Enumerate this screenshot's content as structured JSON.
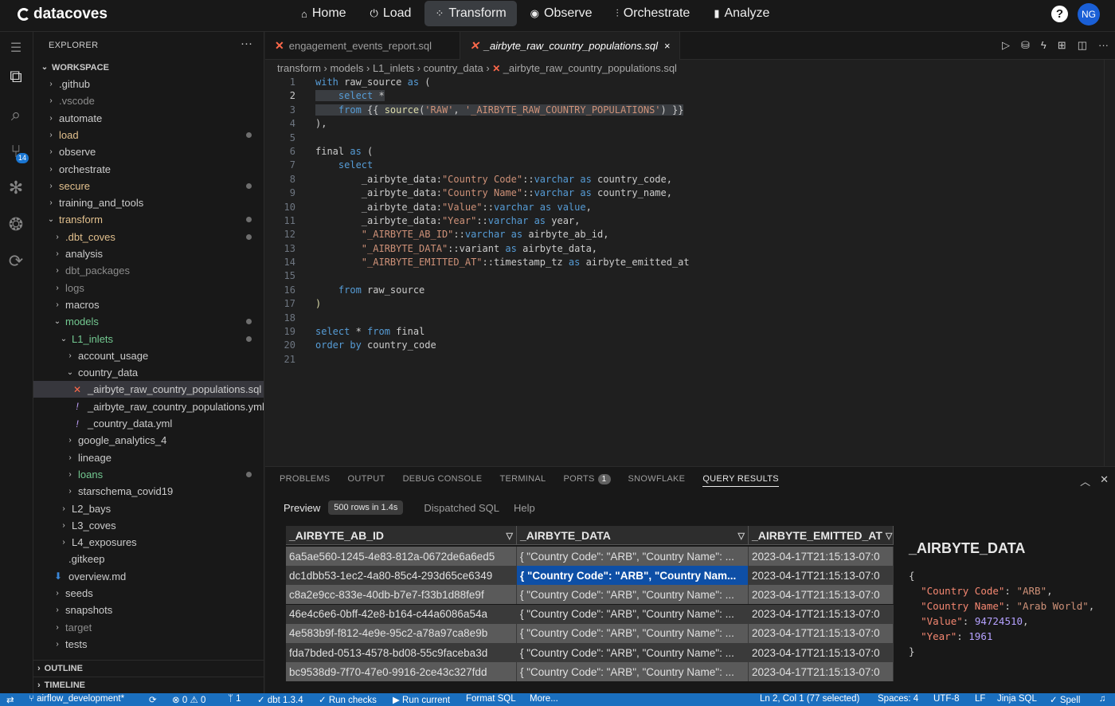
{
  "brand": "datacoves",
  "nav": {
    "tabs": [
      {
        "label": "Home",
        "icon": "home-icon"
      },
      {
        "label": "Load",
        "icon": "load-icon"
      },
      {
        "label": "Transform",
        "icon": "transform-icon",
        "active": true
      },
      {
        "label": "Observe",
        "icon": "eye-icon"
      },
      {
        "label": "Orchestrate",
        "icon": "orchestrate-icon"
      },
      {
        "label": "Analyze",
        "icon": "bar-chart-icon"
      }
    ],
    "help": "?",
    "avatar": "NG"
  },
  "activity_bar": {
    "scm_badge": "14"
  },
  "explorer": {
    "title": "EXPLORER",
    "more": "···",
    "root": "WORKSPACE",
    "items": [
      {
        "label": ".github",
        "indent": 1,
        "kind": "folder",
        "open": false,
        "color": "default"
      },
      {
        "label": ".vscode",
        "indent": 1,
        "kind": "folder",
        "open": false,
        "color": "gray"
      },
      {
        "label": "automate",
        "indent": 1,
        "kind": "folder",
        "open": false,
        "color": "default"
      },
      {
        "label": "load",
        "indent": 1,
        "kind": "folder",
        "open": false,
        "color": "orange",
        "dot": true
      },
      {
        "label": "observe",
        "indent": 1,
        "kind": "folder",
        "open": false,
        "color": "default"
      },
      {
        "label": "orchestrate",
        "indent": 1,
        "kind": "folder",
        "open": false,
        "color": "default"
      },
      {
        "label": "secure",
        "indent": 1,
        "kind": "folder",
        "open": false,
        "color": "orange",
        "dot": true
      },
      {
        "label": "training_and_tools",
        "indent": 1,
        "kind": "folder",
        "open": false,
        "color": "default"
      },
      {
        "label": "transform",
        "indent": 1,
        "kind": "folder",
        "open": true,
        "color": "orange",
        "dot": true
      },
      {
        "label": ".dbt_coves",
        "indent": 2,
        "kind": "folder",
        "open": false,
        "color": "orange",
        "dot": true
      },
      {
        "label": "analysis",
        "indent": 2,
        "kind": "folder",
        "open": false,
        "color": "default"
      },
      {
        "label": "dbt_packages",
        "indent": 2,
        "kind": "folder",
        "open": false,
        "color": "gray"
      },
      {
        "label": "logs",
        "indent": 2,
        "kind": "folder",
        "open": false,
        "color": "gray"
      },
      {
        "label": "macros",
        "indent": 2,
        "kind": "folder",
        "open": false,
        "color": "default"
      },
      {
        "label": "models",
        "indent": 2,
        "kind": "folder",
        "open": true,
        "color": "green",
        "dot": true
      },
      {
        "label": "L1_inlets",
        "indent": 3,
        "kind": "folder",
        "open": true,
        "color": "green",
        "dot": true
      },
      {
        "label": "account_usage",
        "indent": 4,
        "kind": "folder",
        "open": false,
        "color": "default"
      },
      {
        "label": "country_data",
        "indent": 4,
        "kind": "folder",
        "open": true,
        "color": "default"
      },
      {
        "label": "_airbyte_raw_country_populations.sql",
        "indent": 5,
        "kind": "dbt",
        "color": "default",
        "selected": true
      },
      {
        "label": "_airbyte_raw_country_populations.yml",
        "indent": 5,
        "kind": "yml",
        "color": "default"
      },
      {
        "label": "_country_data.yml",
        "indent": 5,
        "kind": "yml",
        "color": "default"
      },
      {
        "label": "google_analytics_4",
        "indent": 4,
        "kind": "folder",
        "open": false,
        "color": "default"
      },
      {
        "label": "lineage",
        "indent": 4,
        "kind": "folder",
        "open": false,
        "color": "default"
      },
      {
        "label": "loans",
        "indent": 4,
        "kind": "folder",
        "open": false,
        "color": "green",
        "dot": true
      },
      {
        "label": "starschema_covid19",
        "indent": 4,
        "kind": "folder",
        "open": false,
        "color": "default"
      },
      {
        "label": "L2_bays",
        "indent": 3,
        "kind": "folder",
        "open": false,
        "color": "default"
      },
      {
        "label": "L3_coves",
        "indent": 3,
        "kind": "folder",
        "open": false,
        "color": "default"
      },
      {
        "label": "L4_exposures",
        "indent": 3,
        "kind": "folder",
        "open": false,
        "color": "default"
      },
      {
        "label": ".gitkeep",
        "indent": 2,
        "kind": "file",
        "color": "default"
      },
      {
        "label": "overview.md",
        "indent": 2,
        "kind": "md",
        "color": "default"
      },
      {
        "label": "seeds",
        "indent": 2,
        "kind": "folder",
        "open": false,
        "color": "default"
      },
      {
        "label": "snapshots",
        "indent": 2,
        "kind": "folder",
        "open": false,
        "color": "default"
      },
      {
        "label": "target",
        "indent": 2,
        "kind": "folder",
        "open": false,
        "color": "gray"
      },
      {
        "label": "tests",
        "indent": 2,
        "kind": "folder",
        "open": false,
        "color": "default"
      }
    ],
    "outline": "OUTLINE",
    "timeline": "TIMELINE"
  },
  "editor": {
    "tabs": [
      {
        "label": "engagement_events_report.sql",
        "active": false
      },
      {
        "label": "_airbyte_raw_country_populations.sql",
        "active": true,
        "close": "×"
      }
    ],
    "breadcrumb": [
      "transform",
      "models",
      "L1_inlets",
      "country_data",
      "_airbyte_raw_country_populations.sql"
    ],
    "current_line": 2,
    "code": [
      [
        {
          "t": "with",
          "c": "kw"
        },
        {
          "t": " raw_source "
        },
        {
          "t": "as",
          "c": "kw"
        },
        {
          "t": " ("
        }
      ],
      [
        {
          "t": "    select",
          "c": "kw",
          "h": 1
        },
        {
          "t": " *",
          "h": 1
        }
      ],
      [
        {
          "t": "    from",
          "c": "kw",
          "h": 1
        },
        {
          "t": " {{ ",
          "h": 1
        },
        {
          "t": "source",
          "c": "fn",
          "h": 1
        },
        {
          "t": "(",
          "h": 1
        },
        {
          "t": "'RAW'",
          "c": "st",
          "h": 1
        },
        {
          "t": ", ",
          "h": 1
        },
        {
          "t": "'_AIRBYTE_RAW_COUNTRY_POPULATIONS'",
          "c": "st",
          "h": 1
        },
        {
          "t": ") }}",
          "h": 1
        }
      ],
      [
        {
          "t": "),"
        }
      ],
      [],
      [
        {
          "t": "final "
        },
        {
          "t": "as",
          "c": "kw"
        },
        {
          "t": " ("
        }
      ],
      [
        {
          "t": "    "
        },
        {
          "t": "select",
          "c": "kw"
        }
      ],
      [
        {
          "t": "        _airbyte_data:"
        },
        {
          "t": "\"Country Code\"",
          "c": "st"
        },
        {
          "t": "::"
        },
        {
          "t": "varchar",
          "c": "kw"
        },
        {
          "t": " "
        },
        {
          "t": "as",
          "c": "kw"
        },
        {
          "t": " country_code,"
        }
      ],
      [
        {
          "t": "        _airbyte_data:"
        },
        {
          "t": "\"Country Name\"",
          "c": "st"
        },
        {
          "t": "::"
        },
        {
          "t": "varchar",
          "c": "kw"
        },
        {
          "t": " "
        },
        {
          "t": "as",
          "c": "kw"
        },
        {
          "t": " country_name,"
        }
      ],
      [
        {
          "t": "        _airbyte_data:"
        },
        {
          "t": "\"Value\"",
          "c": "st"
        },
        {
          "t": "::"
        },
        {
          "t": "varchar",
          "c": "kw"
        },
        {
          "t": " "
        },
        {
          "t": "as",
          "c": "kw"
        },
        {
          "t": " "
        },
        {
          "t": "value",
          "c": "kw"
        },
        {
          "t": ","
        }
      ],
      [
        {
          "t": "        _airbyte_data:"
        },
        {
          "t": "\"Year\"",
          "c": "st"
        },
        {
          "t": "::"
        },
        {
          "t": "varchar",
          "c": "kw"
        },
        {
          "t": " "
        },
        {
          "t": "as",
          "c": "kw"
        },
        {
          "t": " year,"
        }
      ],
      [
        {
          "t": "        "
        },
        {
          "t": "\"_AIRBYTE_AB_ID\"",
          "c": "st"
        },
        {
          "t": "::"
        },
        {
          "t": "varchar",
          "c": "kw"
        },
        {
          "t": " "
        },
        {
          "t": "as",
          "c": "kw"
        },
        {
          "t": " airbyte_ab_id,"
        }
      ],
      [
        {
          "t": "        "
        },
        {
          "t": "\"_AIRBYTE_DATA\"",
          "c": "st"
        },
        {
          "t": "::variant "
        },
        {
          "t": "as",
          "c": "kw"
        },
        {
          "t": " airbyte_data,"
        }
      ],
      [
        {
          "t": "        "
        },
        {
          "t": "\"_AIRBYTE_EMITTED_AT\"",
          "c": "st"
        },
        {
          "t": "::timestamp_tz "
        },
        {
          "t": "as",
          "c": "kw"
        },
        {
          "t": " airbyte_emitted_at"
        }
      ],
      [],
      [
        {
          "t": "    "
        },
        {
          "t": "from",
          "c": "kw"
        },
        {
          "t": " raw_source"
        }
      ],
      [
        {
          "t": ")",
          "c": "fn"
        }
      ],
      [],
      [
        {
          "t": "select",
          "c": "kw"
        },
        {
          "t": " * "
        },
        {
          "t": "from",
          "c": "kw"
        },
        {
          "t": " final"
        }
      ],
      [
        {
          "t": "order by",
          "c": "kw"
        },
        {
          "t": " country_code"
        }
      ],
      []
    ]
  },
  "panel": {
    "tabs": [
      {
        "label": "PROBLEMS"
      },
      {
        "label": "OUTPUT"
      },
      {
        "label": "DEBUG CONSOLE"
      },
      {
        "label": "TERMINAL"
      },
      {
        "label": "PORTS",
        "badge": "1"
      },
      {
        "label": "SNOWFLAKE"
      },
      {
        "label": "QUERY RESULTS",
        "active": true
      }
    ],
    "subtabs": {
      "preview": "Preview",
      "rows_badge": "500 rows in 1.4s",
      "dispatched": "Dispatched SQL",
      "help": "Help"
    },
    "grid": {
      "columns": [
        "_AIRBYTE_AB_ID",
        "_AIRBYTE_DATA",
        "_AIRBYTE_EMITTED_AT"
      ],
      "filter_icon": "▽",
      "rows": [
        [
          "6a5ae560-1245-4e83-812a-0672de6a6ed5",
          "{ \"Country Code\": \"ARB\", \"Country Name\": ...",
          "2023-04-17T21:15:13-07:0"
        ],
        [
          "dc1dbb53-1ec2-4a80-85c4-293d65ce6349",
          "{ \"Country Code\": \"ARB\", \"Country Nam...",
          "2023-04-17T21:15:13-07:0"
        ],
        [
          "c8a2e9cc-833e-40db-b7e7-f33b1d88fe9f",
          "{ \"Country Code\": \"ARB\", \"Country Name\": ...",
          "2023-04-17T21:15:13-07:0"
        ],
        [
          "46e4c6e6-0bff-42e8-b164-c44a6086a54a",
          "{ \"Country Code\": \"ARB\", \"Country Name\": ...",
          "2023-04-17T21:15:13-07:0"
        ],
        [
          "4e583b9f-f812-4e9e-95c2-a78a97ca8e9b",
          "{ \"Country Code\": \"ARB\", \"Country Name\": ...",
          "2023-04-17T21:15:13-07:0"
        ],
        [
          "fda7bded-0513-4578-bd08-55c9faceba3d",
          "{ \"Country Code\": \"ARB\", \"Country Name\": ...",
          "2023-04-17T21:15:13-07:0"
        ],
        [
          "bc9538d9-7f70-47e0-9916-2ce43c327fdd",
          "{ \"Country Code\": \"ARB\", \"Country Name\": ...",
          "2023-04-17T21:15:13-07:0"
        ]
      ],
      "selected_row": 1
    },
    "detail": {
      "title": "_AIRBYTE_DATA",
      "open": "{",
      "close": "}",
      "fields": [
        {
          "key": "\"Country Code\"",
          "value": "\"ARB\"",
          "type": "str"
        },
        {
          "key": "\"Country Name\"",
          "value": "\"Arab World\"",
          "type": "str"
        },
        {
          "key": "\"Value\"",
          "value": "94724510",
          "type": "num"
        },
        {
          "key": "\"Year\"",
          "value": "1961",
          "type": "num"
        }
      ]
    }
  },
  "statusbar": {
    "branch": "airflow_development*",
    "errors": "0",
    "warnings": "0",
    "ports": "1",
    "dbt": "dbt 1.3.4",
    "run_checks": "Run checks",
    "run_current": "Run current",
    "format_sql": "Format SQL",
    "more": "More...",
    "position": "Ln 2, Col 1 (77 selected)",
    "spaces": "Spaces: 4",
    "encoding": "UTF-8",
    "eol": "LF",
    "language": "Jinja SQL",
    "spell": "Spell"
  },
  "colors": {
    "accent": "#1a6fbf",
    "selection": "#0e4fa6",
    "dbt": "#ff694b"
  }
}
